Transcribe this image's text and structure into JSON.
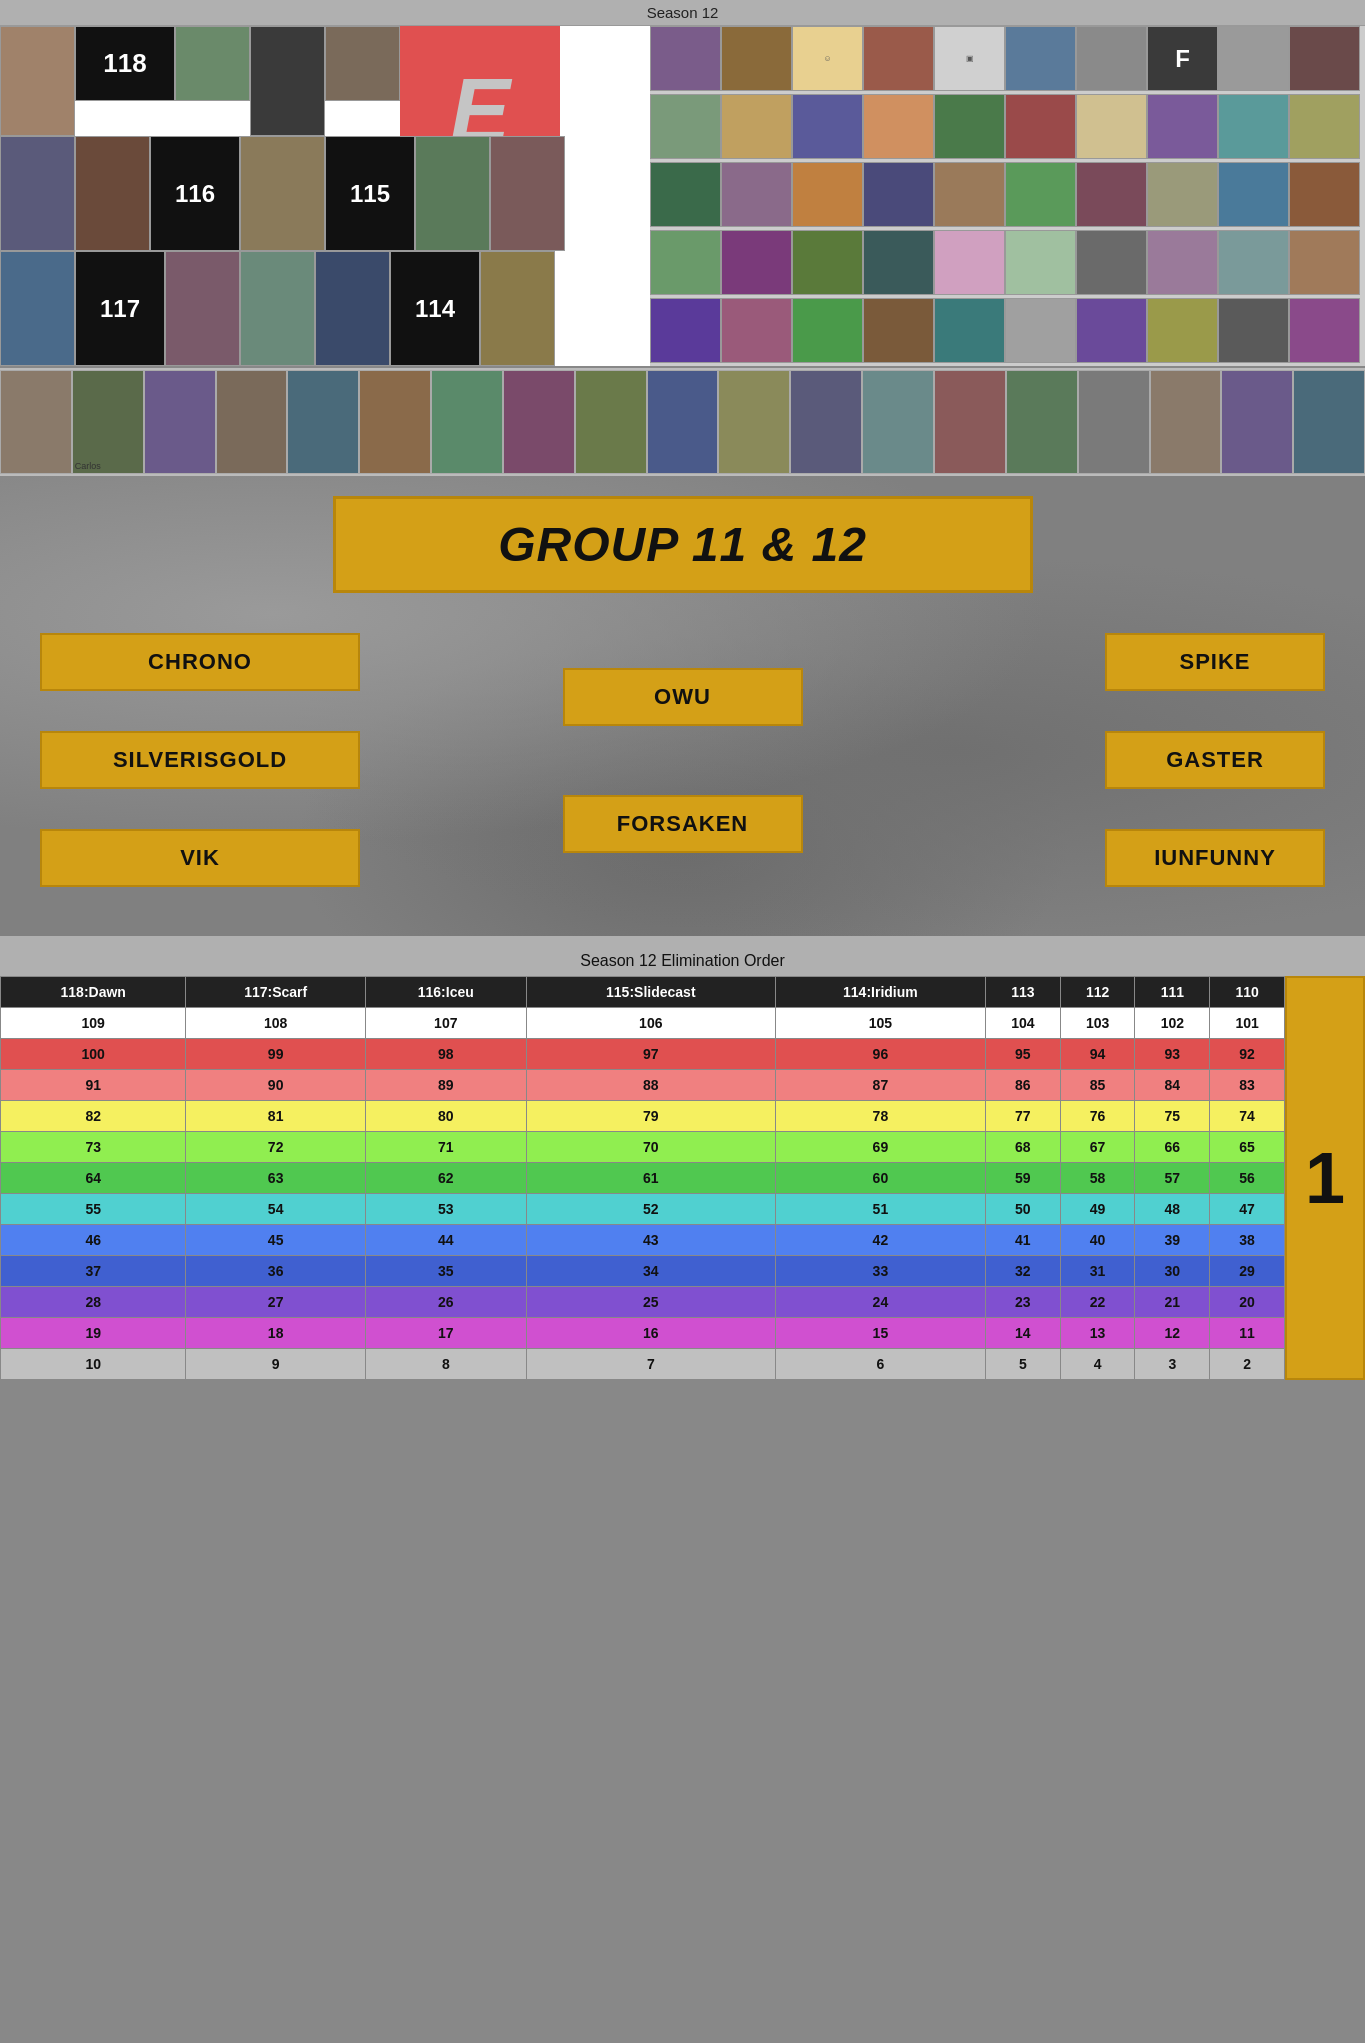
{
  "page": {
    "season_label": "Season 12",
    "e_letter": "E",
    "number_118": "118",
    "number_116": "116",
    "number_115": "115",
    "number_117": "117",
    "number_114": "114",
    "group_title": "GROUP 11 & 12",
    "bracket": {
      "left": [
        "CHRONO",
        "SILVERISGOLD",
        "VIK"
      ],
      "center": [
        "OWU",
        "FORSAKEN"
      ],
      "right": [
        "SPIKE",
        "GASTER",
        "IUNFUNNY"
      ]
    },
    "elim_section_title": "Season 12 Elimination Order",
    "side_number": "1",
    "table": {
      "rows": [
        {
          "cells": [
            "118:Dawn",
            "117:Scarf",
            "116:Iceu",
            "115:Slidecast",
            "114:Iridium",
            "113",
            "112",
            "111",
            "110"
          ],
          "class": "row-header"
        },
        {
          "cells": [
            "109",
            "108",
            "107",
            "106",
            "105",
            "104",
            "103",
            "102",
            "101"
          ],
          "class": "row-white"
        },
        {
          "cells": [
            "100",
            "99",
            "98",
            "97",
            "96",
            "95",
            "94",
            "93",
            "92"
          ],
          "class": "row-red"
        },
        {
          "cells": [
            "91",
            "90",
            "89",
            "88",
            "87",
            "86",
            "85",
            "84",
            "83"
          ],
          "class": "row-salmon"
        },
        {
          "cells": [
            "82",
            "81",
            "80",
            "79",
            "78",
            "77",
            "76",
            "75",
            "74"
          ],
          "class": "row-yellow"
        },
        {
          "cells": [
            "73",
            "72",
            "71",
            "70",
            "69",
            "68",
            "67",
            "66",
            "65"
          ],
          "class": "row-lime"
        },
        {
          "cells": [
            "64",
            "63",
            "62",
            "61",
            "60",
            "59",
            "58",
            "57",
            "56"
          ],
          "class": "row-green"
        },
        {
          "cells": [
            "55",
            "54",
            "53",
            "52",
            "51",
            "50",
            "49",
            "48",
            "47"
          ],
          "class": "row-cyan"
        },
        {
          "cells": [
            "46",
            "45",
            "44",
            "43",
            "42",
            "41",
            "40",
            "39",
            "38"
          ],
          "class": "row-blue"
        },
        {
          "cells": [
            "37",
            "36",
            "35",
            "34",
            "33",
            "32",
            "31",
            "30",
            "29"
          ],
          "class": "row-darkblue"
        },
        {
          "cells": [
            "28",
            "27",
            "26",
            "25",
            "24",
            "23",
            "22",
            "21",
            "20"
          ],
          "class": "row-purple"
        },
        {
          "cells": [
            "19",
            "18",
            "17",
            "16",
            "15",
            "14",
            "13",
            "12",
            "11"
          ],
          "class": "row-magenta"
        },
        {
          "cells": [
            "10",
            "9",
            "8",
            "7",
            "6",
            "5",
            "4",
            "3",
            "2"
          ],
          "class": "row-lastrow"
        }
      ]
    }
  }
}
